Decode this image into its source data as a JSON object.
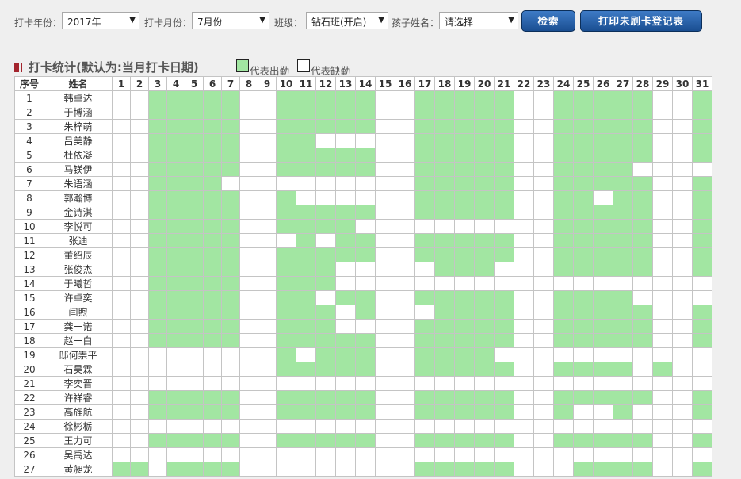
{
  "filters": {
    "year_label": "打卡年份：",
    "year_value": "2017年",
    "month_label": "打卡月份：",
    "month_value": "7月份",
    "class_label": "班级：",
    "class_value": "钻石班(开启)",
    "child_label": "孩子姓名：",
    "child_value": "请选择",
    "search_button": "检索",
    "print_button": "打印未刷卡登记表"
  },
  "legend": {
    "title": "打卡统计(默认为:当月打卡日期)",
    "present_label": "代表出勤",
    "absent_label": "代表缺勤",
    "present_color": "#a2e6a2",
    "absent_color": "#ffffff"
  },
  "table": {
    "index_header": "序号",
    "name_header": "姓名",
    "days": [
      "1",
      "2",
      "3",
      "4",
      "5",
      "6",
      "7",
      "8",
      "9",
      "10",
      "11",
      "12",
      "13",
      "14",
      "15",
      "16",
      "17",
      "18",
      "19",
      "20",
      "21",
      "22",
      "23",
      "24",
      "25",
      "26",
      "27",
      "28",
      "29",
      "30",
      "31"
    ],
    "rows": [
      {
        "index": "1",
        "name": "韩卓达",
        "attendance": "0011111001111100111110011111001"
      },
      {
        "index": "2",
        "name": "于博涵",
        "attendance": "0011111001111100111110011111001"
      },
      {
        "index": "3",
        "name": "朱梓萌",
        "attendance": "0011111001111100111110011111001"
      },
      {
        "index": "4",
        "name": "吕美静",
        "attendance": "0011111001100000111110011111001"
      },
      {
        "index": "5",
        "name": "杜依凝",
        "attendance": "0011111001111100111110011111001"
      },
      {
        "index": "6",
        "name": "马镁伊",
        "attendance": "0011111001111100111110011110000"
      },
      {
        "index": "7",
        "name": "朱语涵",
        "attendance": "0011110000000000111110011111001"
      },
      {
        "index": "8",
        "name": "郭瀚博",
        "attendance": "0011111001000000111110011011001"
      },
      {
        "index": "9",
        "name": "金诗淇",
        "attendance": "0011111001111100111110011111001"
      },
      {
        "index": "10",
        "name": "李悦可",
        "attendance": "0011111001111000000000011111001"
      },
      {
        "index": "11",
        "name": "张迪",
        "attendance": "0011111000101100111110011111001"
      },
      {
        "index": "12",
        "name": "董绍辰",
        "attendance": "0011111001111100111110011111001"
      },
      {
        "index": "13",
        "name": "张俊杰",
        "attendance": "0011111001110000011100011111001"
      },
      {
        "index": "14",
        "name": "于曦哲",
        "attendance": "0011111001110000000000000000000"
      },
      {
        "index": "15",
        "name": "许卓奕",
        "attendance": "0011111001101100111110011110000"
      },
      {
        "index": "16",
        "name": "闫煦",
        "attendance": "0011111001110100011110011111001"
      },
      {
        "index": "17",
        "name": "龚一诺",
        "attendance": "0011111001110000111110011111001"
      },
      {
        "index": "18",
        "name": "赵一白",
        "attendance": "0011111001111100111110011111001"
      },
      {
        "index": "19",
        "name": "邸何崇平",
        "attendance": "0000000001011100111100000000000"
      },
      {
        "index": "20",
        "name": "石昊霖",
        "attendance": "0000000001111100111110011110100"
      },
      {
        "index": "21",
        "name": "李奕晋",
        "attendance": "0000000000000000000000000000000"
      },
      {
        "index": "22",
        "name": "许祥睿",
        "attendance": "0011111001111100111110011111001"
      },
      {
        "index": "23",
        "name": "高旌航",
        "attendance": "0011111001111100111110010010001"
      },
      {
        "index": "24",
        "name": "徐彬栃",
        "attendance": "0000000000000000000000000000000"
      },
      {
        "index": "25",
        "name": "王力可",
        "attendance": "0011111001111100111110011111001"
      },
      {
        "index": "26",
        "name": "吴禹达",
        "attendance": "0000000000000000000000000000000"
      },
      {
        "index": "27",
        "name": "黄昶龙",
        "attendance": "1101111000000000111110001111001"
      }
    ]
  }
}
